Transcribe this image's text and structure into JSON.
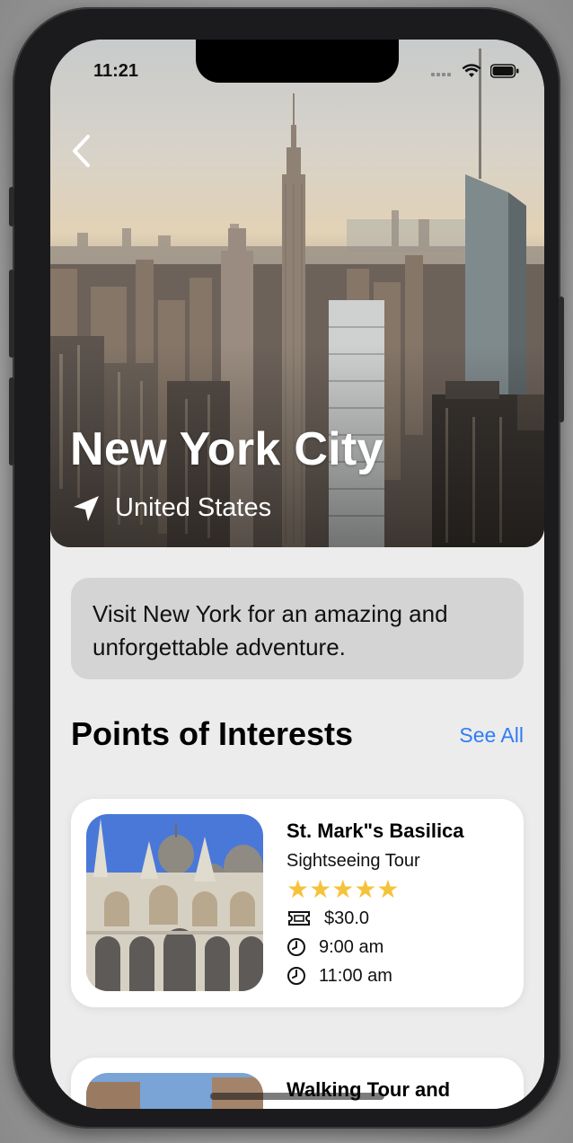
{
  "status": {
    "time": "11:21"
  },
  "hero": {
    "title": "New York City",
    "country": "United States"
  },
  "description": "Visit New York for an amazing and unforgettable adventure.",
  "poi": {
    "heading": "Points of Interests",
    "see_all": "See All",
    "items": [
      {
        "name": "St. Mark\"s Basilica",
        "type": "Sightseeing Tour",
        "rating": 5,
        "stars": "★★★★★",
        "price": "$30.0",
        "start": "9:00 am",
        "end": "11:00 am"
      },
      {
        "name": "Walking Tour and Gondola Ride",
        "visible_name": "Walking Tour and"
      }
    ]
  },
  "colors": {
    "accent": "#2f7cf6",
    "star": "#f5c33b",
    "card": "#ffffff",
    "description_bg": "#d4d4d4",
    "screen_bg": "#ececec"
  },
  "icons": [
    "back-chevron-icon",
    "location-arrow-icon",
    "ticket-icon",
    "clock-icon",
    "signal-icon",
    "wifi-icon",
    "battery-icon"
  ]
}
